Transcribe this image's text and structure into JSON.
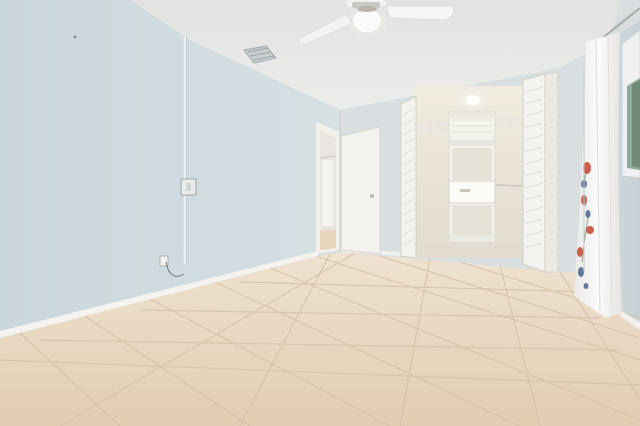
{
  "colors": {
    "ceiling": "#e4e5e3",
    "left_wall": "#cdd8dc",
    "center_wall": "#d9dfe1",
    "right_wall": "#d3dbdd",
    "closet_interior": "#e8e4da",
    "floor": "#e8d7c0",
    "floor_grout": "#d2bfa6",
    "trim": "#f4f3ef",
    "door": "#f3f2ee",
    "curtain": "#f4f3f1",
    "curtain_print": "#c6452f"
  },
  "icons": {
    "ceiling_fan": "ceiling-fan-icon",
    "light": "light-bulb-icon",
    "outlet": "outlet-icon",
    "switch": "light-switch-icon"
  }
}
